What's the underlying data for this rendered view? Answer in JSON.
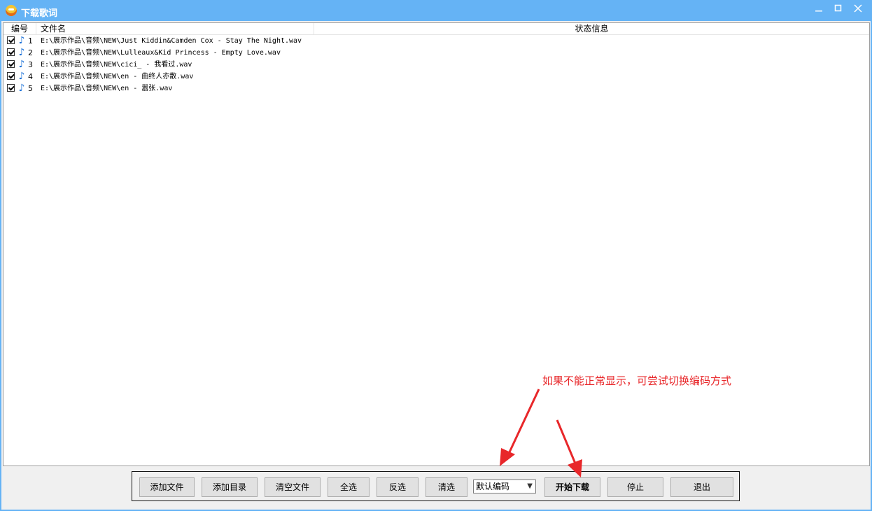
{
  "window": {
    "title": "下载歌词"
  },
  "list": {
    "columns": {
      "no": "编号",
      "file": "文件名",
      "status": "状态信息"
    },
    "rows": [
      {
        "no": "1",
        "file": "E:\\展示作品\\音频\\NEW\\Just Kiddin&Camden Cox - Stay The Night.wav",
        "checked": true
      },
      {
        "no": "2",
        "file": "E:\\展示作品\\音频\\NEW\\Lulleaux&Kid Princess - Empty Love.wav",
        "checked": true
      },
      {
        "no": "3",
        "file": "E:\\展示作品\\音频\\NEW\\cici_ - 我看过.wav",
        "checked": true
      },
      {
        "no": "4",
        "file": "E:\\展示作品\\音频\\NEW\\en - 曲终人亦散.wav",
        "checked": true
      },
      {
        "no": "5",
        "file": "E:\\展示作品\\音频\\NEW\\en - 嚣张.wav",
        "checked": true
      }
    ]
  },
  "hint": "如果不能正常显示，可尝试切换编码方式",
  "toolbar": {
    "add_file": "添加文件",
    "add_dir": "添加目录",
    "clear_files": "清空文件",
    "select_all": "全选",
    "invert": "反选",
    "clear_select": "清选",
    "encoding": "默认编码",
    "start": "开始下载",
    "stop": "停止",
    "exit": "退出"
  },
  "colors": {
    "titlebar": "#65b3f5",
    "hint": "#e8272a",
    "note_icon": "#1f73d8"
  }
}
